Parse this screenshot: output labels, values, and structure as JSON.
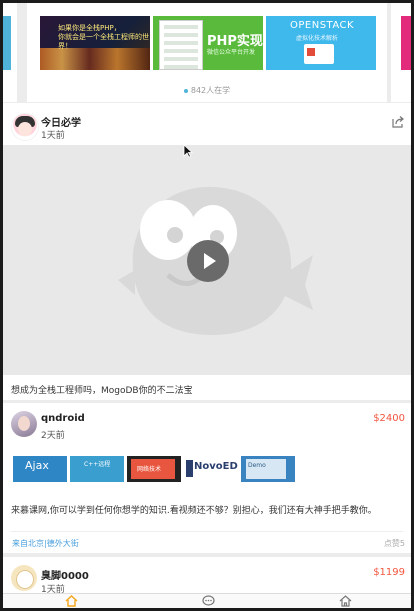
{
  "carousel": {
    "courses": [
      {
        "name": "course-night-city",
        "text": "如果你是全栈PHP，\n你就会是一个全栈工程师的世界！"
      },
      {
        "name": "course-php-wechat",
        "title": "PHP实现",
        "subtitle": "微信公众平台开发"
      },
      {
        "name": "course-openstack",
        "title": "OPENSTACK",
        "subtitle": "虚拟化技术解析"
      }
    ],
    "learners": "842人在学"
  },
  "posts": [
    {
      "username": "今日必学",
      "time": "1天前",
      "text": "想成为全栈工程师吗，MogoDB你的不二法宝"
    },
    {
      "username": "qndroid",
      "time": "2天前",
      "price": "$2400",
      "thumbs": [
        "Ajax",
        "C++远程",
        "网络技术",
        "NovoED",
        "Demo"
      ],
      "text": "来慕课网,你可以学到任何你想学的知识.看视频还不够？别担心，我们还有大神手把手教你。",
      "location": "来自北京|德外大街",
      "likes": "点赞5"
    },
    {
      "username": "臭脚0000",
      "time": "1天前",
      "price": "$1199"
    }
  ],
  "colors": {
    "accent": "#4a9fdc",
    "price": "#f2553f",
    "nav_active": "#f4a81b"
  },
  "nav": [
    "home-icon",
    "chat-icon",
    "house-icon"
  ]
}
